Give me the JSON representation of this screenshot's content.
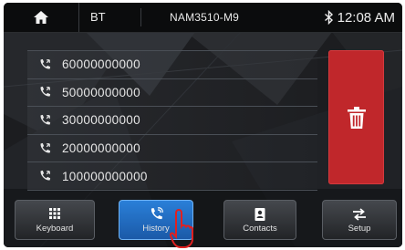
{
  "status_bar": {
    "bt_label": "BT",
    "device_name": "NAM3510-M9",
    "time": "12:08 AM",
    "icons": [
      "home-icon",
      "bluetooth-icon"
    ]
  },
  "call_history": {
    "entries": [
      {
        "number": "60000000000"
      },
      {
        "number": "50000000000"
      },
      {
        "number": "30000000000"
      },
      {
        "number": "20000000000"
      },
      {
        "number": "100000000000"
      }
    ],
    "icon": "phone-icon"
  },
  "delete_button": {
    "icon": "trash-icon",
    "color": "#c0272b"
  },
  "tabs": [
    {
      "label": "Keyboard",
      "icon": "keypad-icon",
      "active": false
    },
    {
      "label": "History",
      "icon": "call-history-icon",
      "active": true
    },
    {
      "label": "Contacts",
      "icon": "contacts-icon",
      "active": false
    },
    {
      "label": "Setup",
      "icon": "swap-arrows-icon",
      "active": false
    }
  ],
  "colors": {
    "accent": "#2a7fd8",
    "delete": "#c0272b",
    "pointer": "#e02020"
  }
}
